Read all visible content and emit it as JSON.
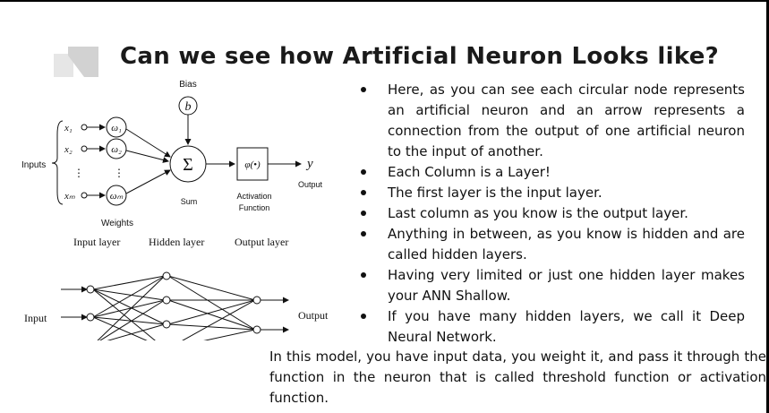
{
  "slide": {
    "title": "Can we see how Artificial Neuron Looks like?"
  },
  "neuron_diagram": {
    "bias_label": "Bias",
    "bias_symbol": "b",
    "inputs_label": "Inputs",
    "input_x1": "x₁",
    "input_x2": "x₂",
    "input_xm": "xₘ",
    "weight_w1": "ω₁",
    "weight_w2": "ω₂",
    "weight_wm": "ωₘ",
    "vdots": "⋮",
    "sum_symbol": "Σ",
    "sum_label": "Sum",
    "activation_symbol": "φ(•)",
    "activation_label_1": "Activation",
    "activation_label_2": "Function",
    "output_symbol": "y",
    "output_label": "Output",
    "weights_label": "Weights"
  },
  "network_diagram": {
    "input_layer_label": "Input layer",
    "hidden_layer_label": "Hidden layer",
    "output_layer_label": "Output layer",
    "input_label": "Input",
    "output_label": "Output"
  },
  "bullets": [
    "Here, as you can see each circular node represents an artificial neuron and an arrow represents a connection from the output of one artificial neuron to the input of another.",
    "Each Column is a Layer!",
    "The first layer is the input layer.",
    "Last column as you know is the output layer.",
    "Anything in between, as you know is hidden and are called hidden layers.",
    "Having very limited or just one hidden layer makes your ANN Shallow.",
    "If you have many hidden layers, we call it Deep Neural Network."
  ],
  "paragraph": "In this model, you have input data, you weight it, and pass it through the function in the neuron that is called threshold function or activation function.",
  "colors": {
    "deco": "#d9d9d9",
    "text": "#111111",
    "frame": "#000000"
  }
}
